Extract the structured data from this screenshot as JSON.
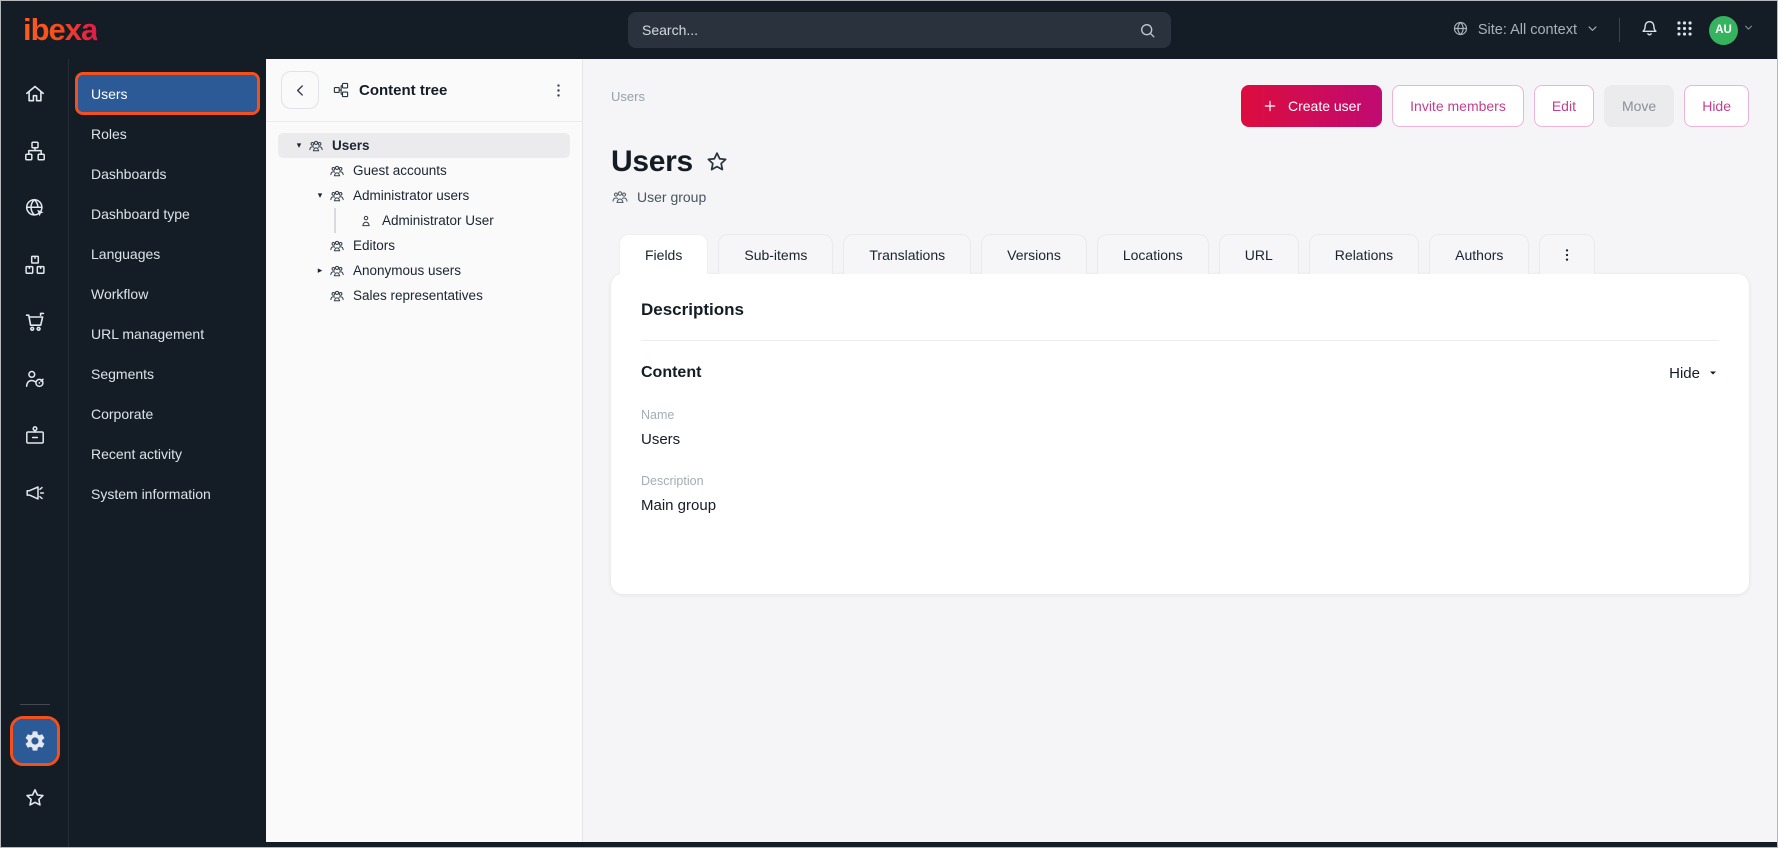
{
  "topbar": {
    "logo_text": "ibexa",
    "search": {
      "placeholder": "Search..."
    },
    "site_context_label": "Site: All context",
    "avatar_initials": "AU",
    "icons": [
      "globe-icon",
      "chevron-down-icon",
      "bell-icon",
      "app-grid-icon"
    ]
  },
  "icon_rail": {
    "icons": [
      "home",
      "content-structure",
      "site",
      "product-catalog",
      "commerce",
      "personalization",
      "corporate",
      "marketing"
    ],
    "footer_icons": [
      "settings",
      "bookmarks"
    ],
    "active_icon": "settings"
  },
  "sidebar": {
    "items": [
      {
        "label": "Users",
        "active": true
      },
      {
        "label": "Roles"
      },
      {
        "label": "Dashboards"
      },
      {
        "label": "Dashboard type"
      },
      {
        "label": "Languages"
      },
      {
        "label": "Workflow"
      },
      {
        "label": "URL management"
      },
      {
        "label": "Segments"
      },
      {
        "label": "Corporate"
      },
      {
        "label": "Recent activity"
      },
      {
        "label": "System information"
      }
    ]
  },
  "content_tree": {
    "title": "Content tree",
    "items": [
      {
        "label": "Users",
        "level": 0,
        "icon": "user-group",
        "expanded": true,
        "selected": true
      },
      {
        "label": "Guest accounts",
        "level": 1,
        "icon": "user-group"
      },
      {
        "label": "Administrator users",
        "level": 1,
        "icon": "user-group",
        "expanded": true
      },
      {
        "label": "Administrator User",
        "level": 2,
        "icon": "user"
      },
      {
        "label": "Editors",
        "level": 1,
        "icon": "user-group"
      },
      {
        "label": "Anonymous users",
        "level": 1,
        "icon": "user-group",
        "collapsed": true
      },
      {
        "label": "Sales representatives",
        "level": 1,
        "icon": "user-group"
      }
    ],
    "carets": {
      "expanded": "▾",
      "collapsed": "▸"
    }
  },
  "main": {
    "breadcrumb": "Users",
    "title": "Users",
    "content_type": "User group",
    "actions": [
      {
        "label": "Create user",
        "style": "primary"
      },
      {
        "label": "Invite members",
        "style": "secondary"
      },
      {
        "label": "Edit",
        "style": "secondary"
      },
      {
        "label": "Move",
        "style": "disabled"
      },
      {
        "label": "Hide",
        "style": "secondary"
      }
    ],
    "tabs": [
      {
        "label": "Fields",
        "active": true
      },
      {
        "label": "Sub-items"
      },
      {
        "label": "Translations"
      },
      {
        "label": "Versions"
      },
      {
        "label": "Locations"
      },
      {
        "label": "URL"
      },
      {
        "label": "Relations"
      },
      {
        "label": "Authors"
      }
    ],
    "panel": {
      "section_title": "Descriptions",
      "group_title": "Content",
      "collapse_toggle_label": "Hide",
      "fields": [
        {
          "label": "Name",
          "value": "Users"
        },
        {
          "label": "Description",
          "value": "Main group"
        }
      ]
    }
  },
  "colors": {
    "topbar_bg": "#141c26",
    "highlight_orange": "#f4501e",
    "active_blue": "#2b5a96",
    "primary_button_gradient": [
      "#dc0c3e",
      "#c00b72"
    ],
    "avatar_green": "#35b35e"
  }
}
